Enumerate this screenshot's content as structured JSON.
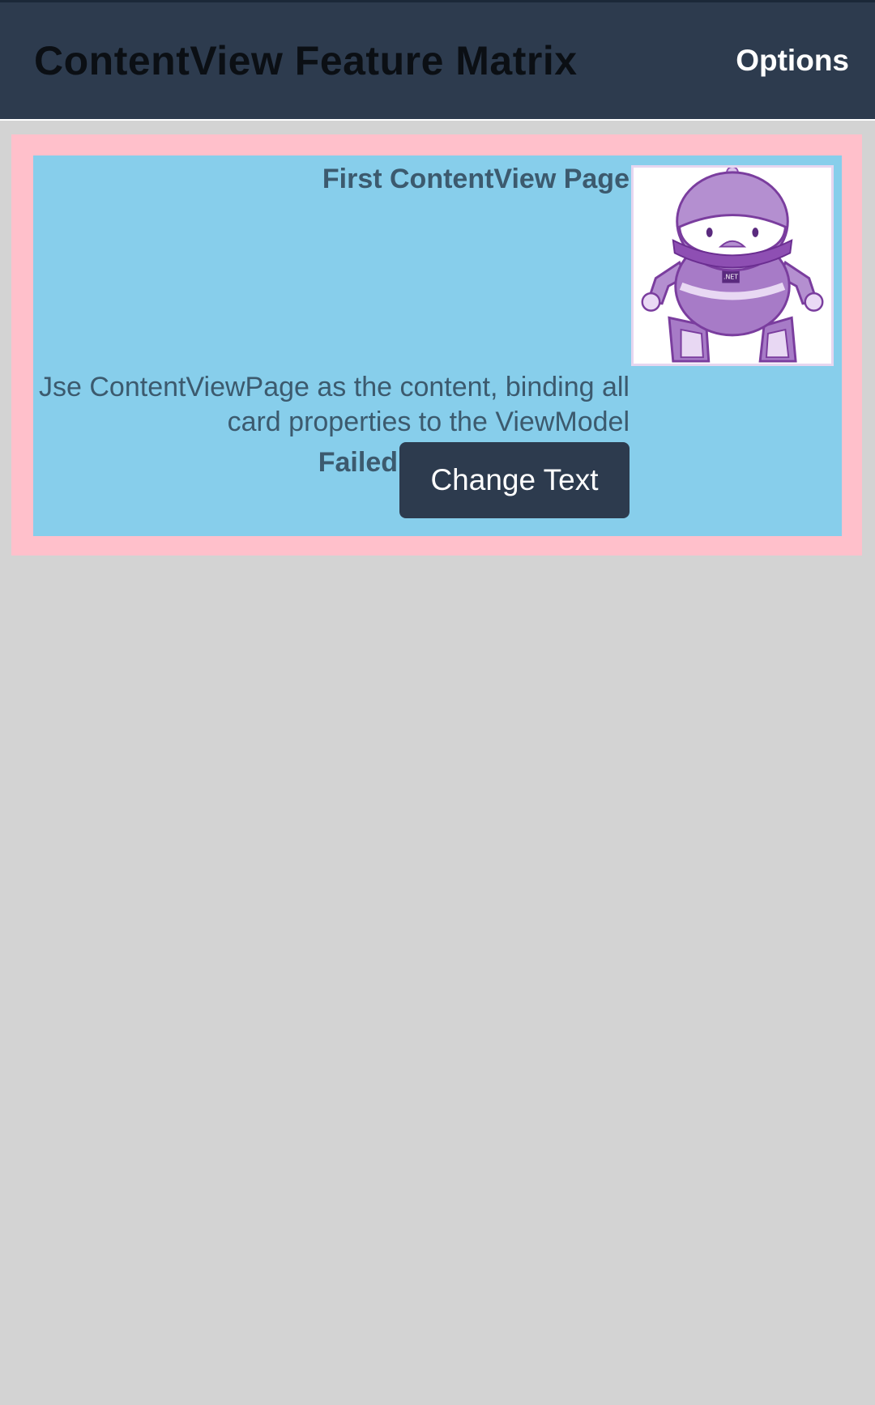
{
  "header": {
    "title": "ContentView Feature Matrix",
    "options_label": "Options"
  },
  "card": {
    "title": "First ContentView Page",
    "description": "Jse ContentViewPage as the content, binding all card properties to the ViewModel",
    "status": "Failed",
    "change_button_label": "Change Text",
    "image": {
      "icon": "dotnet-bot-icon",
      "badge_text": ".NET"
    }
  },
  "colors": {
    "navbar": "#2d3b4e",
    "page_background": "#d3d3d3",
    "card_border": "#ffc0cb",
    "card_background": "#87ceeb",
    "card_text": "#3c5a6e",
    "button": "#2d3b4e"
  }
}
